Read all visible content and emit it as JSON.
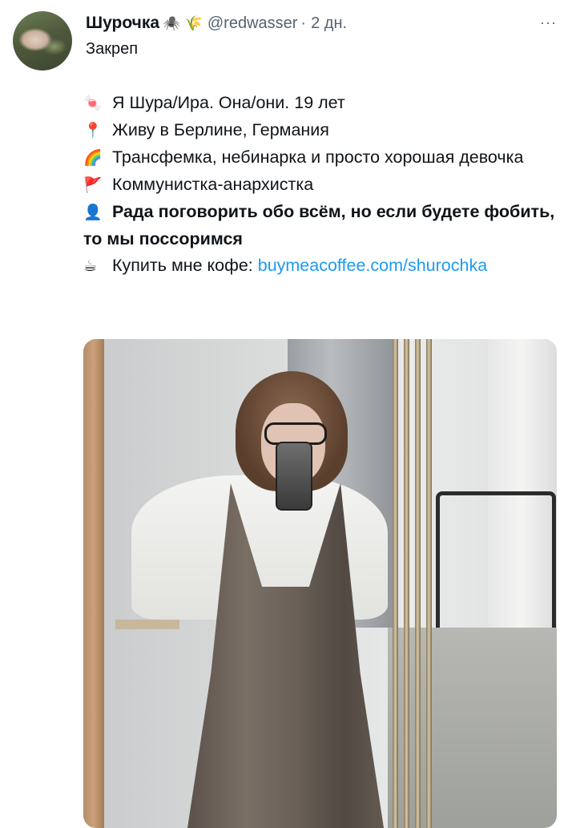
{
  "tweet": {
    "display_name": "Шурочка",
    "badges": "🕷️ 🌾",
    "handle": "@redwasser",
    "separator": "·",
    "time": "2 дн.",
    "more": "···",
    "pinned_label": "Закреп",
    "bio": {
      "line1_emoji": "🍬",
      "line1": "Я Шура/Ира. Она/они. 19 лет",
      "line2_emoji": "📍",
      "line2": "Живу в Берлине, Германия",
      "line3_emoji": "🌈",
      "line3": "Трансфемка, небинарка и просто хорошая девочка",
      "line4_emoji": "🚩",
      "line4": "Коммунистка-анархистка",
      "line5_emoji": "👤",
      "line5": "Рада поговорить обо всём, но если будете фобить, то мы поссоримся",
      "line6_emoji": "☕",
      "line6": "Купить мне кофе: ",
      "line6_link": "buymeacoffee.com/shurochka"
    }
  }
}
